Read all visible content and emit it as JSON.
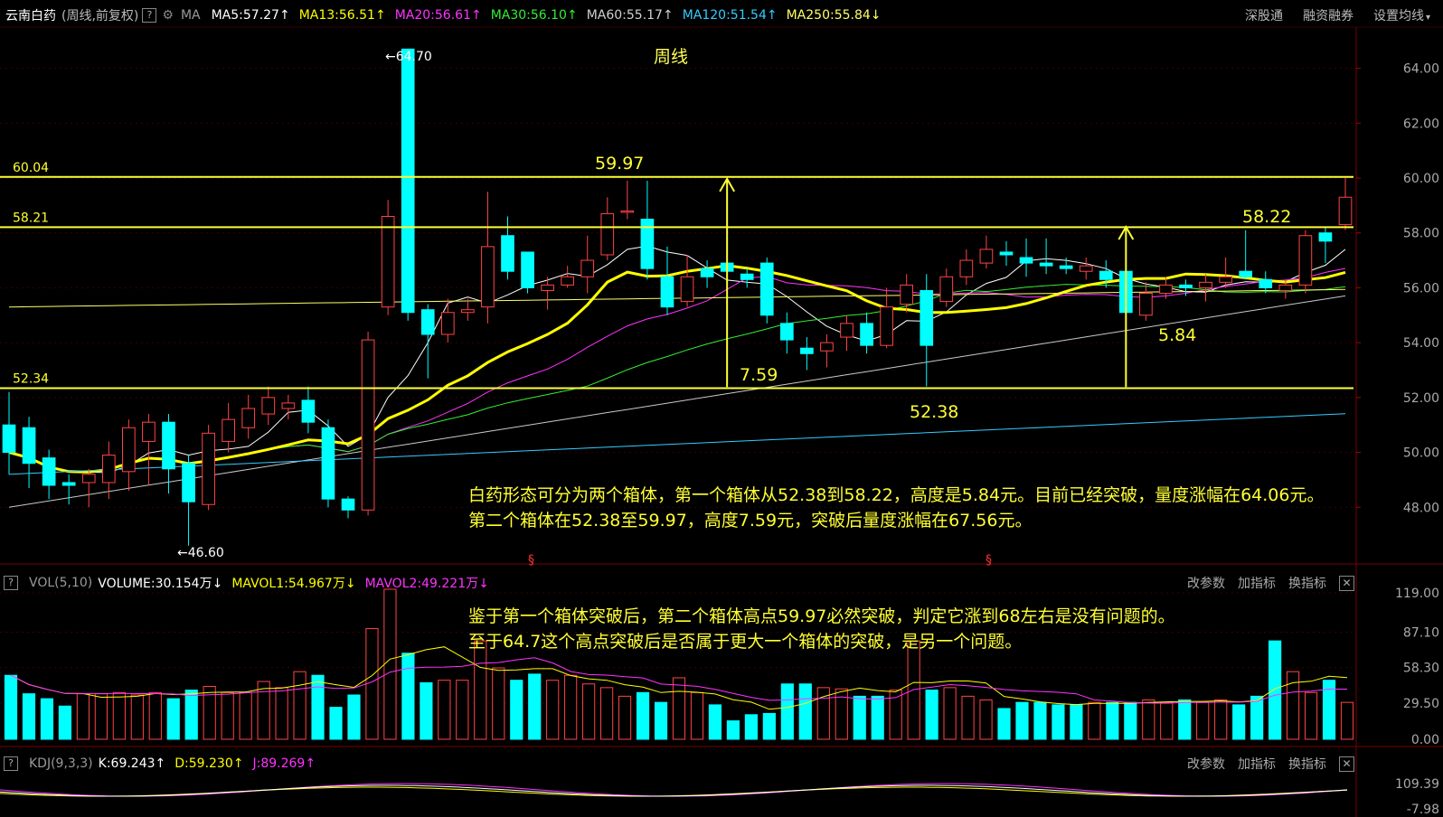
{
  "header": {
    "stock_name": "云南白药",
    "period_label": "(周线,前复权)",
    "ma_label": "MA",
    "indicators": [
      {
        "text": "MA5:57.27",
        "arrow": "↑",
        "color": "#ffffff"
      },
      {
        "text": "MA13:56.51",
        "arrow": "↑",
        "color": "#ffff00"
      },
      {
        "text": "MA20:56.61",
        "arrow": "↑",
        "color": "#ff33ff"
      },
      {
        "text": "MA30:56.10",
        "arrow": "↑",
        "color": "#33ee33"
      },
      {
        "text": "MA60:55.17",
        "arrow": "↑",
        "color": "#d0d0d0"
      },
      {
        "text": "MA120:51.54",
        "arrow": "↑",
        "color": "#33ccff"
      },
      {
        "text": "MA250:55.84",
        "arrow": "↓",
        "color": "#ffff66"
      }
    ],
    "menu": [
      "深股通",
      "融资融券",
      "设置均线"
    ]
  },
  "chart_title": "周线",
  "price_labels": {
    "high": "64.70",
    "low": "46.60",
    "line_60_04": "60.04",
    "line_58_21": "58.21",
    "line_52_34": "52.34",
    "box_top_2": "59.97",
    "box_top_1": "58.22",
    "box_bottom": "52.38",
    "height_2": "7.59",
    "height_1": "5.84"
  },
  "notes": {
    "line1": "白药形态可分为两个箱体，第一个箱体从52.38到58.22，高度是5.84元。目前已经突破，量度涨幅在64.06元。",
    "line2": "第二个箱体在52.38至59.97，高度7.59元，突破后量度涨幅在67.56元。",
    "line3": "鉴于第一个箱体突破后，第二个箱体高点59.97必然突破，判定它涨到68左右是没有问题的。",
    "line4": "至于64.7这个高点突破后是否属于更大一个箱体的突破，是另一个问题。"
  },
  "markers": [
    "§",
    "§"
  ],
  "volume_panel": {
    "title": "VOL(5,10)",
    "indicators": [
      {
        "text": "VOLUME:30.154万",
        "arrow": "↓",
        "color": "#ffffff"
      },
      {
        "text": "MAVOL1:54.967万",
        "arrow": "↓",
        "color": "#ffff00"
      },
      {
        "text": "MAVOL2:49.221万",
        "arrow": "↓",
        "color": "#ff33ff"
      }
    ],
    "menu": [
      "改参数",
      "加指标",
      "换指标"
    ]
  },
  "kdj_panel": {
    "title": "KDJ(9,3,3)",
    "indicators": [
      {
        "text": "K:69.243",
        "arrow": "↑",
        "color": "#ffffff"
      },
      {
        "text": "D:59.230",
        "arrow": "↑",
        "color": "#ffff00"
      },
      {
        "text": "J:89.269",
        "arrow": "↑",
        "color": "#ff33ff"
      }
    ],
    "menu": [
      "改参数",
      "加指标",
      "换指标"
    ]
  },
  "colors": {
    "up": "#ff4444",
    "down": "#00ffff",
    "box_line": "#ffff33",
    "grid": "#3a0000",
    "ma5": "#ffffff",
    "ma13": "#ffff00",
    "ma20": "#ff33ff",
    "ma30": "#33ee33",
    "ma60": "#c8c8c8",
    "ma120": "#33ccff",
    "ma250": "#ffff66"
  },
  "chart_data": {
    "type": "candlestick",
    "price_axis": {
      "ticks": [
        "64.00",
        "62.00",
        "60.00",
        "58.00",
        "56.00",
        "54.00",
        "52.00",
        "50.00",
        "48.00"
      ],
      "range": [
        46.0,
        65.5
      ]
    },
    "horizontal_lines": [
      60.04,
      58.21,
      52.34
    ],
    "arrows": [
      {
        "x_index": 36,
        "from": 52.38,
        "to": 59.97,
        "label": "7.59"
      },
      {
        "x_index": 56,
        "from": 52.38,
        "to": 58.22,
        "label": "5.84"
      }
    ],
    "candles": [
      [
        51.0,
        50.0,
        52.2,
        49.2
      ],
      [
        50.9,
        49.6,
        51.3,
        48.7
      ],
      [
        49.8,
        48.8,
        50.1,
        48.3
      ],
      [
        48.9,
        48.8,
        49.2,
        48.1
      ],
      [
        48.9,
        49.2,
        49.4,
        48.0
      ],
      [
        48.9,
        49.9,
        50.4,
        48.3
      ],
      [
        49.3,
        50.9,
        51.2,
        48.6
      ],
      [
        50.4,
        51.1,
        51.4,
        48.8
      ],
      [
        51.1,
        49.4,
        51.4,
        48.5
      ],
      [
        49.6,
        48.2,
        49.9,
        46.6
      ],
      [
        48.1,
        50.7,
        51.0,
        47.9
      ],
      [
        50.4,
        51.2,
        51.8,
        50.0
      ],
      [
        50.9,
        51.6,
        52.1,
        50.5
      ],
      [
        51.4,
        52.0,
        52.4,
        51.0
      ],
      [
        51.6,
        51.8,
        52.1,
        51.2
      ],
      [
        51.9,
        51.1,
        52.4,
        50.7
      ],
      [
        50.9,
        48.3,
        51.2,
        48.0
      ],
      [
        48.3,
        47.9,
        48.4,
        47.6
      ],
      [
        47.9,
        54.1,
        54.4,
        47.7
      ],
      [
        55.3,
        58.6,
        59.2,
        55.0
      ],
      [
        64.7,
        55.1,
        64.7,
        54.8
      ],
      [
        55.2,
        54.3,
        55.4,
        52.7
      ],
      [
        54.3,
        55.1,
        55.6,
        54.0
      ],
      [
        55.1,
        55.2,
        55.6,
        54.8
      ],
      [
        55.3,
        57.5,
        59.5,
        54.7
      ],
      [
        57.9,
        56.6,
        58.6,
        56.3
      ],
      [
        57.3,
        56.0,
        57.3,
        55.8
      ],
      [
        55.9,
        56.1,
        56.4,
        55.2
      ],
      [
        56.1,
        56.4,
        56.8,
        56.0
      ],
      [
        56.4,
        57.0,
        57.9,
        55.8
      ],
      [
        57.2,
        58.7,
        59.3,
        57.0
      ],
      [
        58.8,
        58.8,
        59.9,
        58.5
      ],
      [
        58.5,
        56.7,
        59.9,
        56.3
      ],
      [
        56.4,
        55.3,
        57.5,
        55.0
      ],
      [
        55.5,
        56.4,
        57.2,
        55.3
      ],
      [
        56.7,
        56.4,
        57.0,
        56.0
      ],
      [
        56.9,
        56.6,
        57.0,
        56.1
      ],
      [
        56.5,
        56.3,
        56.7,
        56.0
      ],
      [
        56.9,
        55.0,
        57.1,
        54.7
      ],
      [
        54.7,
        54.1,
        55.1,
        53.6
      ],
      [
        53.8,
        53.6,
        54.2,
        53.0
      ],
      [
        53.7,
        54.0,
        54.3,
        53.1
      ],
      [
        54.2,
        54.7,
        55.0,
        53.7
      ],
      [
        54.7,
        53.9,
        55.1,
        53.6
      ],
      [
        53.9,
        55.3,
        56.0,
        53.8
      ],
      [
        55.4,
        56.1,
        56.5,
        55.1
      ],
      [
        55.9,
        53.9,
        56.5,
        52.4
      ],
      [
        55.5,
        56.4,
        56.7,
        55.3
      ],
      [
        56.4,
        57.0,
        57.4,
        56.1
      ],
      [
        56.9,
        57.4,
        57.9,
        56.7
      ],
      [
        57.3,
        57.2,
        57.7,
        56.8
      ],
      [
        57.1,
        56.9,
        57.8,
        56.4
      ],
      [
        56.9,
        56.8,
        57.8,
        56.5
      ],
      [
        56.8,
        56.7,
        57.1,
        56.5
      ],
      [
        56.6,
        56.8,
        57.1,
        56.3
      ],
      [
        56.6,
        56.3,
        57.0,
        56.0
      ],
      [
        56.6,
        55.1,
        56.8,
        54.9
      ],
      [
        55.0,
        55.8,
        56.2,
        54.8
      ],
      [
        55.8,
        56.1,
        56.4,
        55.6
      ],
      [
        56.1,
        56.0,
        56.3,
        55.7
      ],
      [
        56.0,
        56.2,
        56.5,
        55.5
      ],
      [
        56.2,
        56.4,
        57.1,
        56.0
      ],
      [
        56.6,
        56.4,
        58.1,
        56.3
      ],
      [
        56.3,
        56.0,
        56.6,
        55.8
      ],
      [
        55.9,
        56.1,
        56.3,
        55.6
      ],
      [
        56.1,
        57.9,
        58.1,
        55.8
      ],
      [
        58.0,
        57.7,
        58.2,
        56.9
      ],
      [
        58.3,
        59.3,
        60.0,
        58.1
      ]
    ],
    "volume": {
      "ticks": [
        "119.00",
        "87.10",
        "58.30",
        "29.50",
        "0.00"
      ],
      "max": 122,
      "values": [
        52,
        37,
        33,
        27,
        37,
        37,
        38,
        36,
        38,
        33,
        40,
        43,
        38,
        38,
        47,
        42,
        55,
        52,
        26,
        36,
        90,
        122,
        70,
        46,
        48,
        48,
        80,
        58,
        48,
        53,
        48,
        52,
        45,
        42,
        35,
        38,
        30,
        50,
        38,
        28,
        15,
        20,
        21,
        45,
        45,
        42,
        41,
        35,
        35,
        40,
        80,
        40,
        42,
        35,
        32,
        25,
        30,
        30,
        28,
        28,
        30,
        30,
        30,
        32,
        30,
        32,
        30,
        32,
        28,
        35,
        80,
        55,
        38,
        48,
        30
      ]
    }
  }
}
